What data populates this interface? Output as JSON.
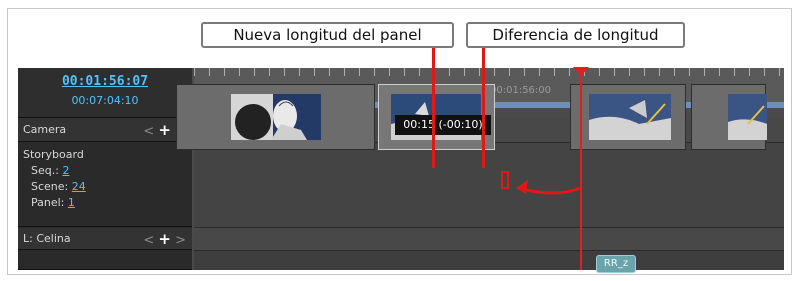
{
  "callouts": {
    "new_panel_length": "Nueva longitud del panel",
    "length_difference": "Diferencia de longitud"
  },
  "timecode": {
    "current": "00:01:56:07",
    "total": "00:07:04:10"
  },
  "ruler": {
    "tick_label": "00:01:56:00"
  },
  "tracks": {
    "camera": {
      "label": "Camera",
      "prev": "<",
      "add": "+",
      "next": ">"
    },
    "storyboard": {
      "label": "Storyboard",
      "seq_label": "Seq.:",
      "seq_value": "2",
      "scene_label": "Scene:",
      "scene_value": "24",
      "panel_label": "Panel:",
      "panel_value": "1"
    },
    "celina": {
      "label": "L: Celina",
      "prev": "<",
      "add": "+",
      "next": ">"
    }
  },
  "panel_duration": "00:15 (-00:10)",
  "marker_tag": "RR_z",
  "colors": {
    "accent": "#4ec3ff",
    "playhead": "#e02020",
    "annotation": "#e01818"
  }
}
